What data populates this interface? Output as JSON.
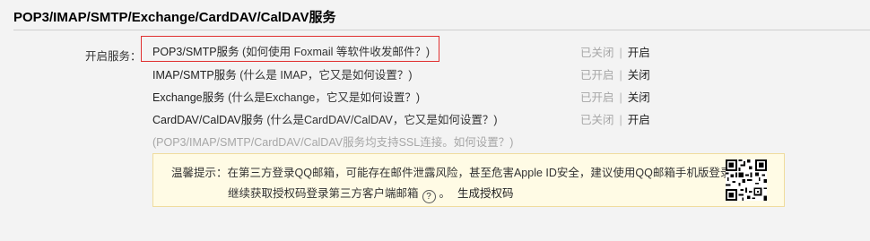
{
  "section": {
    "title": "POP3/IMAP/SMTP/Exchange/CardDAV/CalDAV服务"
  },
  "open_label": "开启服务：",
  "services": [
    {
      "name": "POP3/SMTP服务",
      "desc": " (如何使用 Foxmail 等软件收发邮件？)",
      "state": "已关闭",
      "sep": "|",
      "action": "开启"
    },
    {
      "name": "IMAP/SMTP服务",
      "desc": " (什么是 IMAP，它又是如何设置？)",
      "state": "已开启",
      "sep": "|",
      "action": "关闭"
    },
    {
      "name": "Exchange服务",
      "desc": " (什么是Exchange，它又是如何设置？)",
      "state": "已开启",
      "sep": "|",
      "action": "关闭"
    },
    {
      "name": "CardDAV/CalDAV服务",
      "desc": " (什么是CardDAV/CalDAV，它又是如何设置？)",
      "state": "已关闭",
      "sep": "|",
      "action": "开启"
    }
  ],
  "ssl_note": {
    "prefix": "(POP3/IMAP/SMTP/CardDAV/CalDAV服务均支持SSL连接。",
    "link": "如何设置？",
    "suffix": ")"
  },
  "tip": {
    "line1": "温馨提示：在第三方登录QQ邮箱，可能存在邮件泄露风险，甚至危害Apple ID安全，建议使用QQ邮箱手机版登录。",
    "line2": "继续获取授权码登录第三方客户端邮箱",
    "help_glyph": "?",
    "period": "。",
    "generate_link": "生成授权码"
  },
  "colors": {
    "highlight_border": "#e03030",
    "tip_background": "#fffbe5",
    "tip_border": "#f0dc9e",
    "muted_text": "#a6a6a6"
  },
  "icons": {
    "qr": "qr-code-icon",
    "help": "question-circle-icon"
  }
}
